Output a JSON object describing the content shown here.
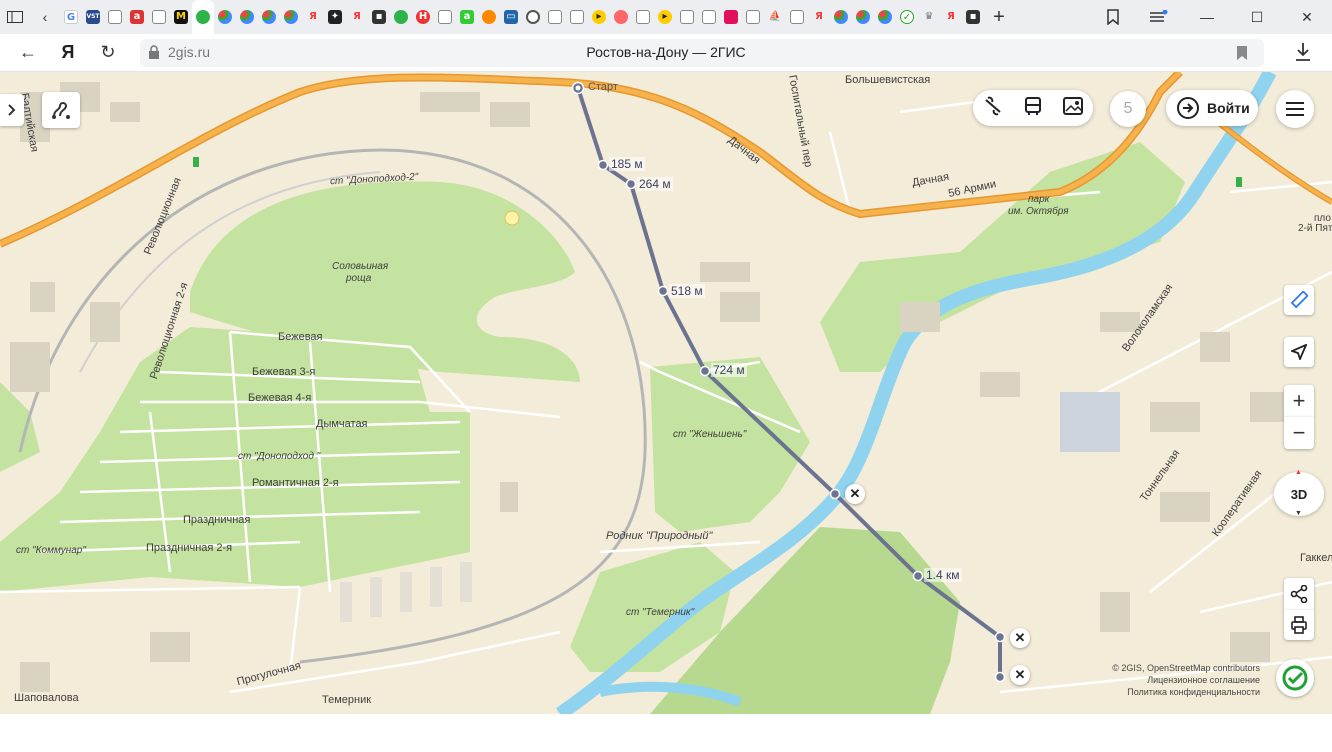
{
  "browser": {
    "new_tab_label": "+",
    "tab_count_badge": "5"
  },
  "address": {
    "host": "2gis.ru",
    "page_title": "Ростов-на-Дону — 2ГИС"
  },
  "map_ui": {
    "login_label": "Войти",
    "counter": "5",
    "btn_3d": "3D",
    "zoom_in": "+",
    "zoom_out": "−"
  },
  "route": {
    "start_label": "Старт",
    "distances": [
      "185 м",
      "264 м",
      "518 м",
      "724 м",
      "1.4 км"
    ]
  },
  "labels": {
    "dnopodhod2": "ст \"Доноподход-2\"",
    "solovinaya1": "Соловьиная",
    "solovinaya2": "роща",
    "beževaya": "Бежевая",
    "bezhevaya3": "Бежевая 3-я",
    "bezhevaya4": "Бежевая 4-я",
    "dymchataya": "Дымчатая",
    "dnopodhod": "ст \"Доноподход \"",
    "romantichnaya2": "Романтичная 2-я",
    "prazdnichnaya": "Праздничная",
    "prazdnichnaya2": "Праздничная 2-я",
    "kommunar": "ст \"Коммунар\"",
    "revolyucionnaya": "Революционная",
    "revolyucionnaya2": "Революционная 2-я",
    "zhenshen": "ст \"Женьшень\"",
    "rodnik": "Родник \"Природный\"",
    "temernik_st": "ст \"Темерник\"",
    "temernik": "Темерник",
    "progulochnaya": "Прогулочная",
    "shapovalova": "Шаповалова",
    "dachnaya1": "Дачная",
    "dachnaya2": "Дачная",
    "armii": "56 Армии",
    "gospitalny": "Госпитальный пер",
    "bolshevistskaya": "Большевистская",
    "park1": "парк",
    "park2": "им. Октября",
    "volokolamskaya": "Волоколамская",
    "tonnelnaya": "Тоннельная",
    "kooperativnaya": "Кооперативная",
    "gakkel": "Гаккел",
    "plosch": "пло",
    "pyatiletki": "2-й Пят",
    "baltiyskaya": "Балтийская"
  },
  "copyright": {
    "line1": "© 2GIS, OpenStreetMap contributors",
    "line2": "Лицензионное соглашение",
    "line3": "Политика конфиденциальности"
  },
  "colors": {
    "road_orange": "#f0a030",
    "route": "#6b7390",
    "river": "#8fd3ee",
    "green": "#c5e3a0",
    "map_bg": "#f3ecd9"
  }
}
